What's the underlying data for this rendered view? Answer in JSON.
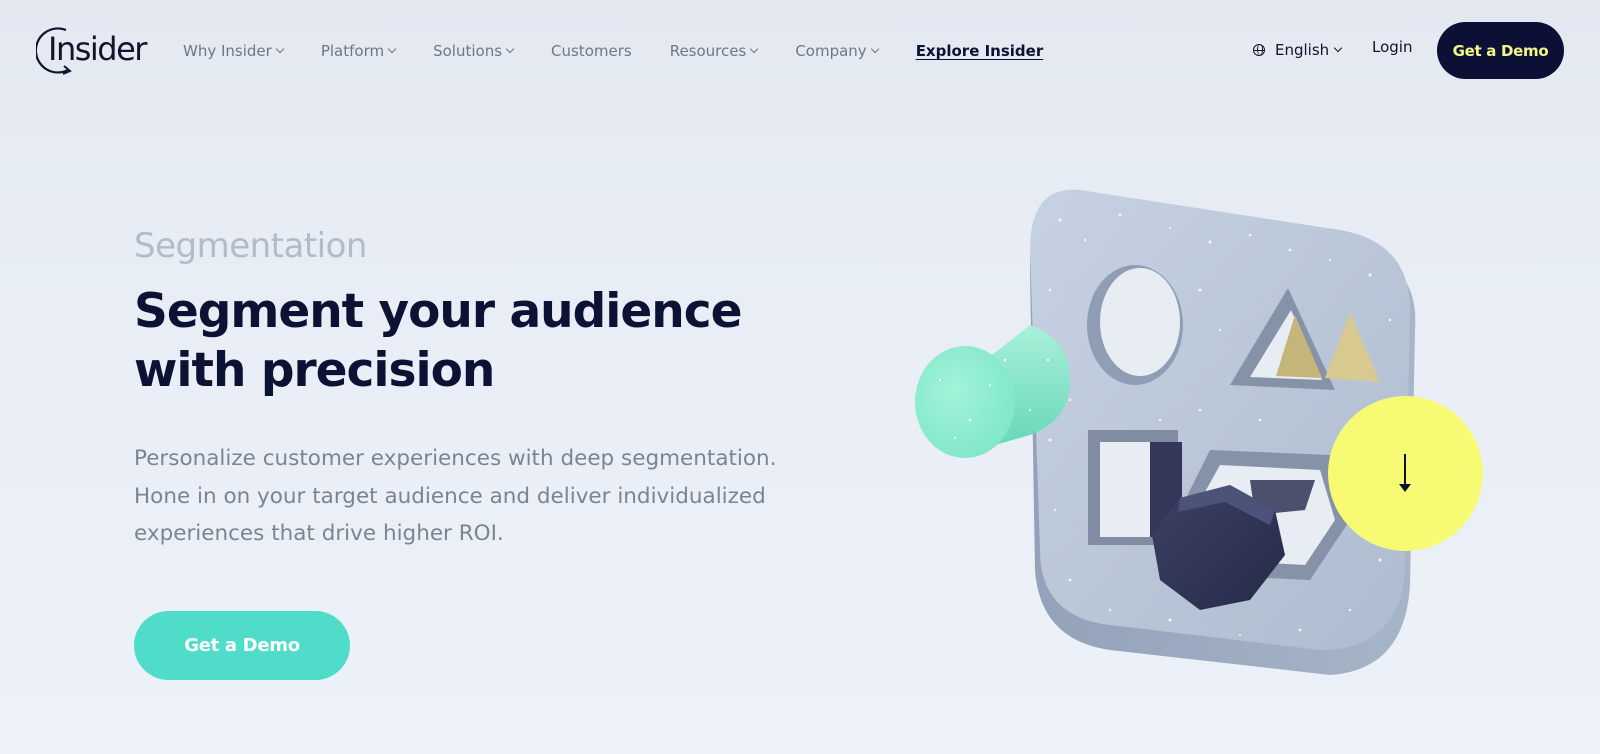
{
  "header": {
    "logo_text": "Insider",
    "nav": [
      {
        "label": "Why Insider",
        "dropdown": true
      },
      {
        "label": "Platform",
        "dropdown": true
      },
      {
        "label": "Solutions",
        "dropdown": true
      },
      {
        "label": "Customers",
        "dropdown": false
      },
      {
        "label": "Resources",
        "dropdown": true
      },
      {
        "label": "Company",
        "dropdown": true
      },
      {
        "label": "Explore Insider",
        "dropdown": false
      }
    ],
    "language": "English",
    "login_label": "Login",
    "demo_label": "Get a Demo"
  },
  "hero": {
    "eyebrow": "Segmentation",
    "headline_line1": "Segment your audience",
    "headline_line2": "with precision",
    "description": "Personalize customer experiences with deep segmentation. Hone in on your target audience and deliver individualized experiences that drive higher ROI.",
    "cta_label": "Get a Demo"
  },
  "icons": {
    "globe": "globe-icon",
    "chevron": "chevron-down-icon",
    "scroll": "arrow-down-icon"
  },
  "colors": {
    "brand_dark": "#0b1034",
    "accent_yellow": "#f7fb74",
    "accent_teal": "#4fddc9"
  }
}
